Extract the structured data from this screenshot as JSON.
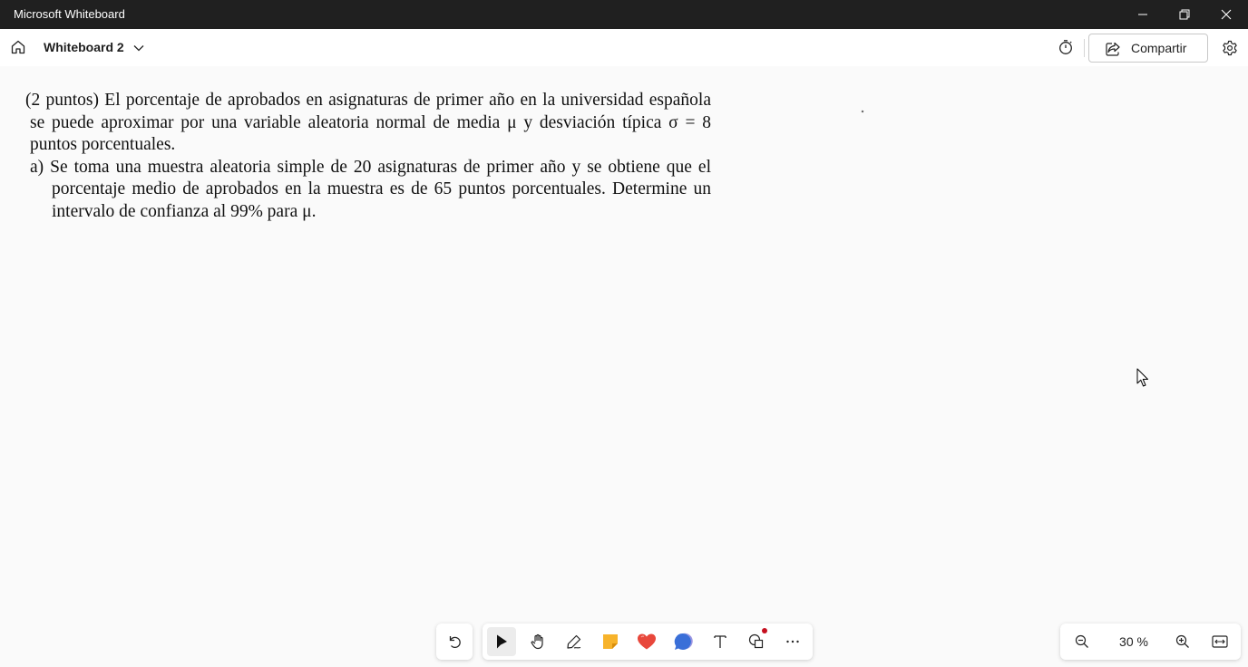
{
  "window": {
    "title": "Microsoft Whiteboard",
    "controls": [
      "minimize-icon",
      "restore-icon",
      "close-icon"
    ]
  },
  "header": {
    "board_name": "Whiteboard 2",
    "share_label": "Compartir",
    "icons": [
      "home-icon",
      "chevron-down-icon",
      "timer-icon",
      "share-icon",
      "gear-icon"
    ]
  },
  "canvas": {
    "problem_intro": "(2 puntos) El porcentaje de aprobados en asignaturas de primer año en la universidad española se puede aproximar por una variable aleatoria normal de media μ y desviación típica σ = 8 puntos porcentuales.",
    "problem_part_a": "a) Se toma una muestra aleatoria simple de 20 asignaturas de primer año y se obtiene que el porcentaje medio de aprobados en la muestra es de 65 puntos porcentuales. Determine un intervalo de confianza al 99% para μ."
  },
  "toolbar": {
    "tools": [
      "undo-icon",
      "select-icon",
      "hand-icon",
      "pen-icon",
      "sticky-note-icon",
      "reaction-heart-icon",
      "comment-icon",
      "text-icon",
      "shapes-icon",
      "more-icon"
    ],
    "selected_tool": "select-icon"
  },
  "zoom": {
    "level": "30 %",
    "icons": [
      "zoom-out-icon",
      "zoom-in-icon",
      "fit-to-screen-icon"
    ]
  },
  "colors": {
    "titlebar": "#202020",
    "sticky_note": "#f7b32b",
    "heart": "#e8473b",
    "comment": "#3a6fd8",
    "notification_dot": "#c50f1f"
  }
}
